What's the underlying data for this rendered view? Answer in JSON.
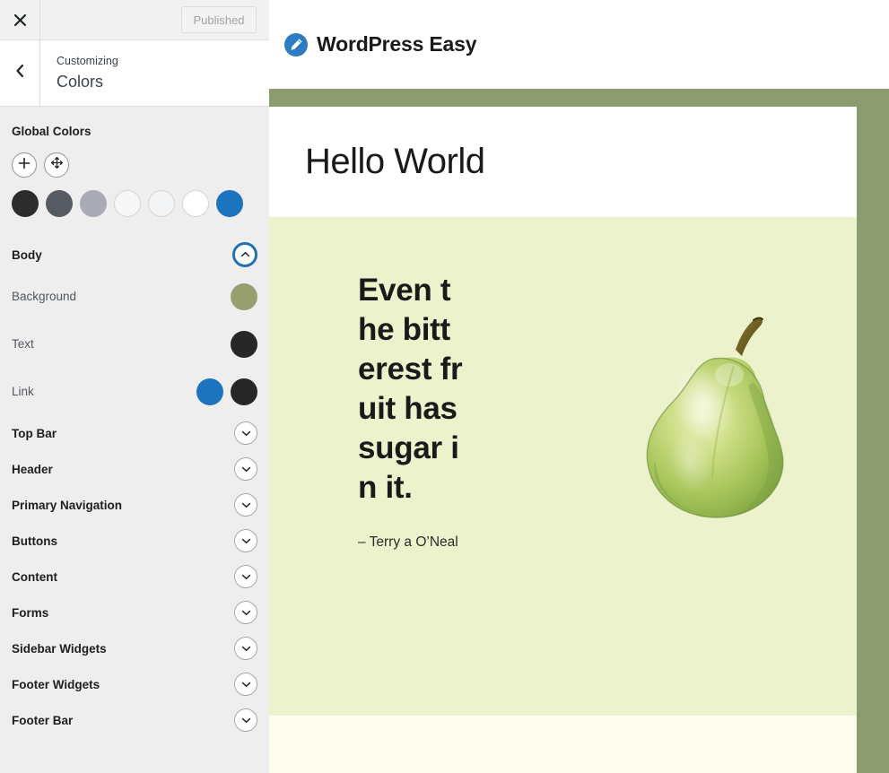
{
  "sidebar": {
    "topbar": {
      "close_icon": "close-icon",
      "publish_label": "Published"
    },
    "header": {
      "back_icon": "chevron-left-icon",
      "eyebrow": "Customizing",
      "title": "Colors"
    },
    "global_colors": {
      "title": "Global Colors",
      "actions": [
        {
          "name": "add-color-button",
          "icon": "plus-icon"
        },
        {
          "name": "reorder-colors-button",
          "icon": "move-arrows-icon"
        }
      ],
      "swatches": [
        {
          "name": "global-color-1",
          "color": "#2b2b2b",
          "light": false
        },
        {
          "name": "global-color-2",
          "color": "#565a62",
          "light": false
        },
        {
          "name": "global-color-3",
          "color": "#a8abb6",
          "light": false
        },
        {
          "name": "global-color-4",
          "color": "#f7f7f7",
          "light": true
        },
        {
          "name": "global-color-5",
          "color": "#f3f4f5",
          "light": true
        },
        {
          "name": "global-color-6",
          "color": "#ffffff",
          "light": true
        },
        {
          "name": "global-color-7",
          "color": "#1e73be",
          "light": false
        }
      ]
    },
    "body_section": {
      "label": "Body",
      "expanded": true,
      "toggle_icon": "chevron-up-icon",
      "options": [
        {
          "label": "Background",
          "name": "body-background",
          "colors": [
            {
              "value": "#96a06f",
              "name": "body-background-color"
            }
          ]
        },
        {
          "label": "Text",
          "name": "body-text",
          "colors": [
            {
              "value": "#262626",
              "name": "body-text-color"
            }
          ]
        },
        {
          "label": "Link",
          "name": "body-link",
          "colors": [
            {
              "value": "#1e73be",
              "name": "body-link-color"
            },
            {
              "value": "#262626",
              "name": "body-link-hover-color"
            }
          ]
        }
      ]
    },
    "sections": [
      {
        "label": "Top Bar",
        "name": "section-top-bar",
        "toggle_icon": "chevron-down-icon"
      },
      {
        "label": "Header",
        "name": "section-header",
        "toggle_icon": "chevron-down-icon"
      },
      {
        "label": "Primary Navigation",
        "name": "section-primary-navigation",
        "toggle_icon": "chevron-down-icon"
      },
      {
        "label": "Buttons",
        "name": "section-buttons",
        "toggle_icon": "chevron-down-icon"
      },
      {
        "label": "Content",
        "name": "section-content",
        "toggle_icon": "chevron-down-icon"
      },
      {
        "label": "Forms",
        "name": "section-forms",
        "toggle_icon": "chevron-down-icon"
      },
      {
        "label": "Sidebar Widgets",
        "name": "section-sidebar-widgets",
        "toggle_icon": "chevron-down-icon"
      },
      {
        "label": "Footer Widgets",
        "name": "section-footer-widgets",
        "toggle_icon": "chevron-down-icon"
      },
      {
        "label": "Footer Bar",
        "name": "section-footer-bar",
        "toggle_icon": "chevron-down-icon"
      }
    ]
  },
  "preview": {
    "site_title": "WordPress Easy",
    "logo_icon": "pencil-icon",
    "hero_title": "Hello World",
    "quote_text": "Even the bitterest fruit has sugar in it.",
    "quote_cite": "– Terry a O’Neal",
    "image_alt": "pear-illustration",
    "colors": {
      "outer_background": "#8d9c6f",
      "card_background": "#ffffff",
      "quote_background": "#ecf2cc",
      "footer_background": "#fdfdee",
      "brand_blue": "#2b7cc2"
    }
  }
}
